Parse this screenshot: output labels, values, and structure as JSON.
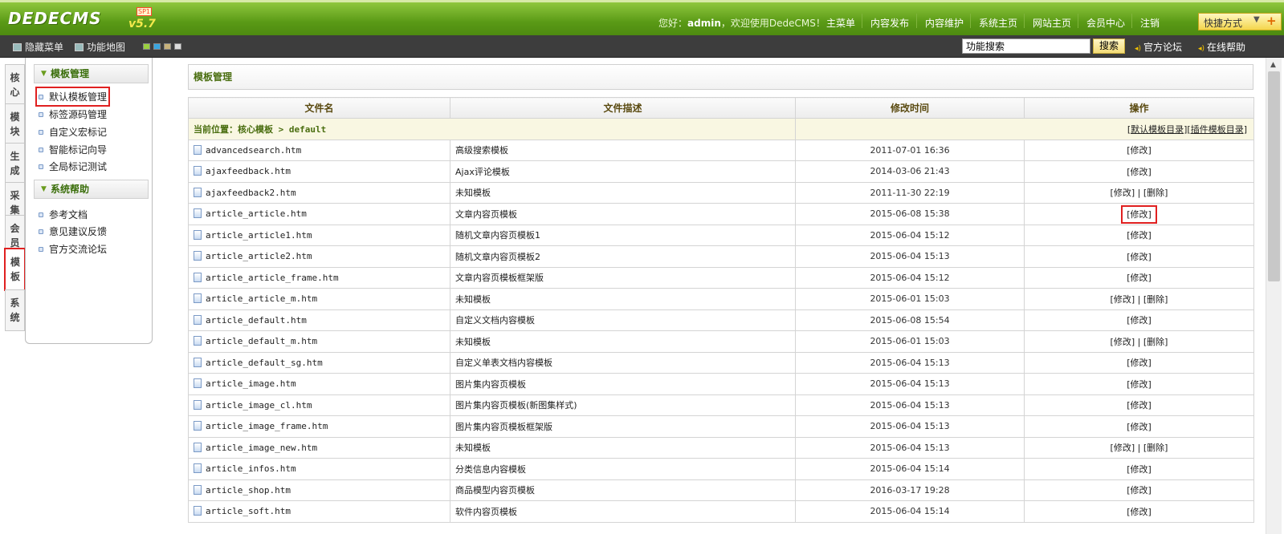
{
  "header": {
    "logo_text": "DEDECMS",
    "version": "v5.7",
    "version_badge": "SP1",
    "greeting_prefix": "您好：",
    "user": "admin",
    "greeting_suffix": "，欢迎使用DedeCMS！",
    "nav": [
      "主菜单",
      "内容发布",
      "内容维护",
      "系统主页",
      "网站主页",
      "会员中心",
      "注销"
    ],
    "quick_label": "快捷方式"
  },
  "toolbar": {
    "hide_menu": "隐藏菜单",
    "func_map": "功能地图",
    "swatch_colors": [
      "#9ad13f",
      "#39a5e0",
      "#c8b27a",
      "#dcdcdc"
    ],
    "search_value": "功能搜索",
    "search_button": "搜索",
    "forum_link": "官方论坛",
    "help_link": "在线帮助"
  },
  "vtabs": [
    {
      "label": "核\n心"
    },
    {
      "label": "模\n块"
    },
    {
      "label": "生\n成"
    },
    {
      "label": "采\n集"
    },
    {
      "label": "会\n员"
    },
    {
      "label": "模\n板"
    },
    {
      "label": "系\n统"
    }
  ],
  "sidemenu": {
    "groups": [
      {
        "title": "模板管理",
        "items": [
          "默认模板管理",
          "标签源码管理",
          "自定义宏标记",
          "智能标记向导",
          "全局标记测试"
        ]
      },
      {
        "title": "系统帮助",
        "items": [
          "参考文档",
          "意见建议反馈",
          "官方交流论坛"
        ]
      }
    ]
  },
  "main": {
    "title": "模板管理",
    "columns": [
      "文件名",
      "文件描述",
      "修改时间",
      "操作"
    ],
    "location_label": "当前位置：",
    "location_path": "核心模板 > default",
    "location_links": [
      "[默认模板目录]",
      "[插件模板目录]"
    ],
    "rows": [
      {
        "file": "advancedsearch.htm",
        "desc": "高级搜索模板",
        "time": "2011-07-01 16:36",
        "op": "[修改]"
      },
      {
        "file": "ajaxfeedback.htm",
        "desc": "Ajax评论模板",
        "time": "2014-03-06 21:43",
        "op": "[修改]"
      },
      {
        "file": "ajaxfeedback2.htm",
        "desc": "未知模板",
        "time": "2011-11-30 22:19",
        "op": "[修改] | [删除]"
      },
      {
        "file": "article_article.htm",
        "desc": "文章内容页模板",
        "time": "2015-06-08 15:38",
        "op": "[修改]"
      },
      {
        "file": "article_article1.htm",
        "desc": "随机文章内容页模板1",
        "time": "2015-06-04 15:12",
        "op": "[修改]"
      },
      {
        "file": "article_article2.htm",
        "desc": "随机文章内容页模板2",
        "time": "2015-06-04 15:13",
        "op": "[修改]"
      },
      {
        "file": "article_article_frame.htm",
        "desc": "文章内容页模板框架版",
        "time": "2015-06-04 15:12",
        "op": "[修改]"
      },
      {
        "file": "article_article_m.htm",
        "desc": "未知模板",
        "time": "2015-06-01 15:03",
        "op": "[修改] | [删除]"
      },
      {
        "file": "article_default.htm",
        "desc": "自定义文档内容模板",
        "time": "2015-06-08 15:54",
        "op": "[修改]"
      },
      {
        "file": "article_default_m.htm",
        "desc": "未知模板",
        "time": "2015-06-01 15:03",
        "op": "[修改] | [删除]"
      },
      {
        "file": "article_default_sg.htm",
        "desc": "自定义单表文档内容模板",
        "time": "2015-06-04 15:13",
        "op": "[修改]"
      },
      {
        "file": "article_image.htm",
        "desc": "图片集内容页模板",
        "time": "2015-06-04 15:13",
        "op": "[修改]"
      },
      {
        "file": "article_image_cl.htm",
        "desc": "图片集内容页模板(新图集样式)",
        "time": "2015-06-04 15:13",
        "op": "[修改]"
      },
      {
        "file": "article_image_frame.htm",
        "desc": "图片集内容页模板框架版",
        "time": "2015-06-04 15:13",
        "op": "[修改]"
      },
      {
        "file": "article_image_new.htm",
        "desc": "未知模板",
        "time": "2015-06-04 15:13",
        "op": "[修改] | [删除]"
      },
      {
        "file": "article_infos.htm",
        "desc": "分类信息内容模板",
        "time": "2015-06-04 15:14",
        "op": "[修改]"
      },
      {
        "file": "article_shop.htm",
        "desc": "商品模型内容页模板",
        "time": "2016-03-17 19:28",
        "op": "[修改]"
      },
      {
        "file": "article_soft.htm",
        "desc": "软件内容页模板",
        "time": "2015-06-04 15:14",
        "op": "[修改]"
      }
    ]
  }
}
